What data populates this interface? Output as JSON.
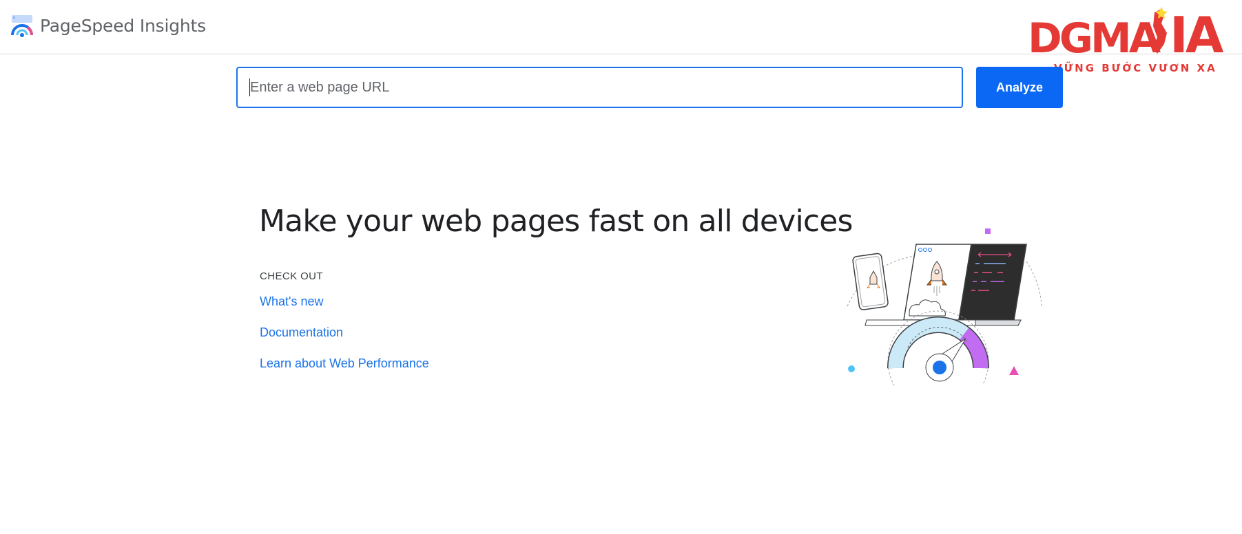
{
  "header": {
    "app_title": "PageSpeed Insights",
    "logo_icon": "pagespeed-gauge-logo-icon"
  },
  "watermark": {
    "logo_text": "DGMASIA",
    "slogan": "VỮNG BƯỚC VƯƠN XA",
    "color": "#e53935"
  },
  "search": {
    "placeholder": "Enter a web page URL",
    "value": "",
    "analyze_label": "Analyze"
  },
  "hero": {
    "title": "Make your web pages fast on all devices",
    "checkout_label": "CHECK OUT",
    "links": [
      {
        "label": "What's new"
      },
      {
        "label": "Documentation"
      },
      {
        "label": "Learn about Web Performance"
      }
    ],
    "illustration_icon": "devices-speed-gauge-illustration-icon"
  },
  "colors": {
    "accent": "#1a73e8",
    "button": "#0b68f5",
    "divider": "#dadce0",
    "text": "#202124"
  }
}
